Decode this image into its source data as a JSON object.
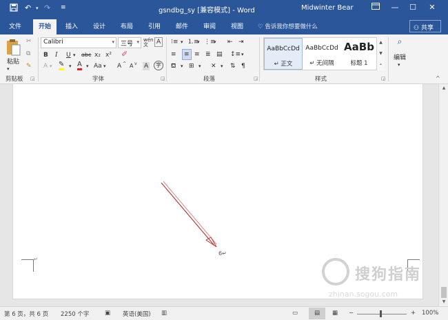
{
  "titlebar": {
    "title": "gsndbg_sy [兼容模式] - Word",
    "user": "Midwinter Bear",
    "save_icon": "save-icon",
    "undo_icon": "undo-icon",
    "redo_icon": "redo-icon",
    "bg_color": "#2b579a"
  },
  "tabs": [
    "文件",
    "开始",
    "插入",
    "设计",
    "布局",
    "引用",
    "邮件",
    "审阅",
    "视图"
  ],
  "tell_me": "告诉我你想要做什么",
  "share": "共享",
  "ribbon": {
    "clipboard": {
      "paste": "粘贴",
      "label": "剪贴板"
    },
    "font": {
      "name": "Calibri",
      "size": "三号",
      "buttons": [
        "B",
        "I",
        "U",
        "abc",
        "x₂",
        "x²"
      ],
      "label": "字体",
      "row3": [
        "A",
        "A",
        "Aa",
        "A",
        "A",
        "A",
        "字"
      ]
    },
    "paragraph": {
      "label": "段落"
    },
    "styles": {
      "items": [
        {
          "sample": "AaBbCcDd",
          "name": "↵ 正文"
        },
        {
          "sample": "AaBbCcDd",
          "name": "↵ 无间隔"
        },
        {
          "sample": "AaBb",
          "name": "标题 1"
        }
      ],
      "label": "样式"
    },
    "editing": {
      "label": "编辑"
    }
  },
  "document": {
    "page_number": "6↵",
    "corner_mark": "↵"
  },
  "watermark": {
    "text": "搜狗指南",
    "url": "zhinan.sogou.com"
  },
  "status": {
    "page": "第 6 页，共 6 页",
    "words": "2250 个字",
    "language": "英语(美国)",
    "zoom": "100%"
  }
}
